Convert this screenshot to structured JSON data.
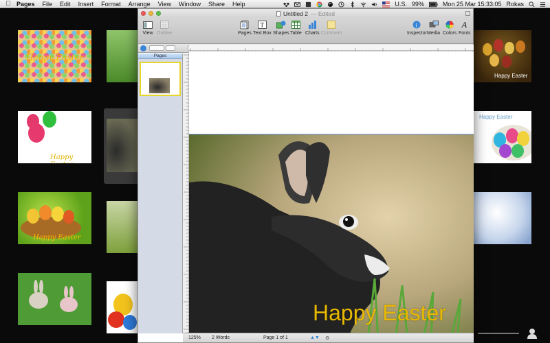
{
  "menubar": {
    "apple": "",
    "items": [
      "Pages",
      "File",
      "Edit",
      "Insert",
      "Format",
      "Arrange",
      "View",
      "Window",
      "Share",
      "Help"
    ],
    "status": {
      "input_source": "U.S.",
      "battery": "99%",
      "datetime": "Mon 25 Mar  15:33:05",
      "user": "Rokas"
    }
  },
  "window": {
    "title": "Untitled 2",
    "edited": "— Edited"
  },
  "toolbar": {
    "view": "View",
    "outline": "Outline",
    "pages": "Pages",
    "textbox": "Text Box",
    "shapes": "Shapes",
    "table": "Table",
    "charts": "Charts",
    "comment": "Comment",
    "inspector": "Inspector",
    "media": "Media",
    "colors": "Colors",
    "fonts": "Fonts"
  },
  "pages_pane": {
    "header": "Pages"
  },
  "document": {
    "caption": "Happy Easter"
  },
  "statusbar": {
    "zoom": "125%",
    "words": "2 Words",
    "page": "Page 1 of 1"
  },
  "thumbnails": [
    {
      "caption": "Happy Easter"
    },
    {
      "caption": "Happy Easter"
    },
    {
      "caption": "Happy Easter"
    },
    {
      "caption": "Happy Easter"
    },
    {
      "caption": "Happy Easter"
    }
  ],
  "colors": {
    "caption": "#e9b800",
    "selection": "#e8d52b",
    "accent": "#3478d6"
  }
}
